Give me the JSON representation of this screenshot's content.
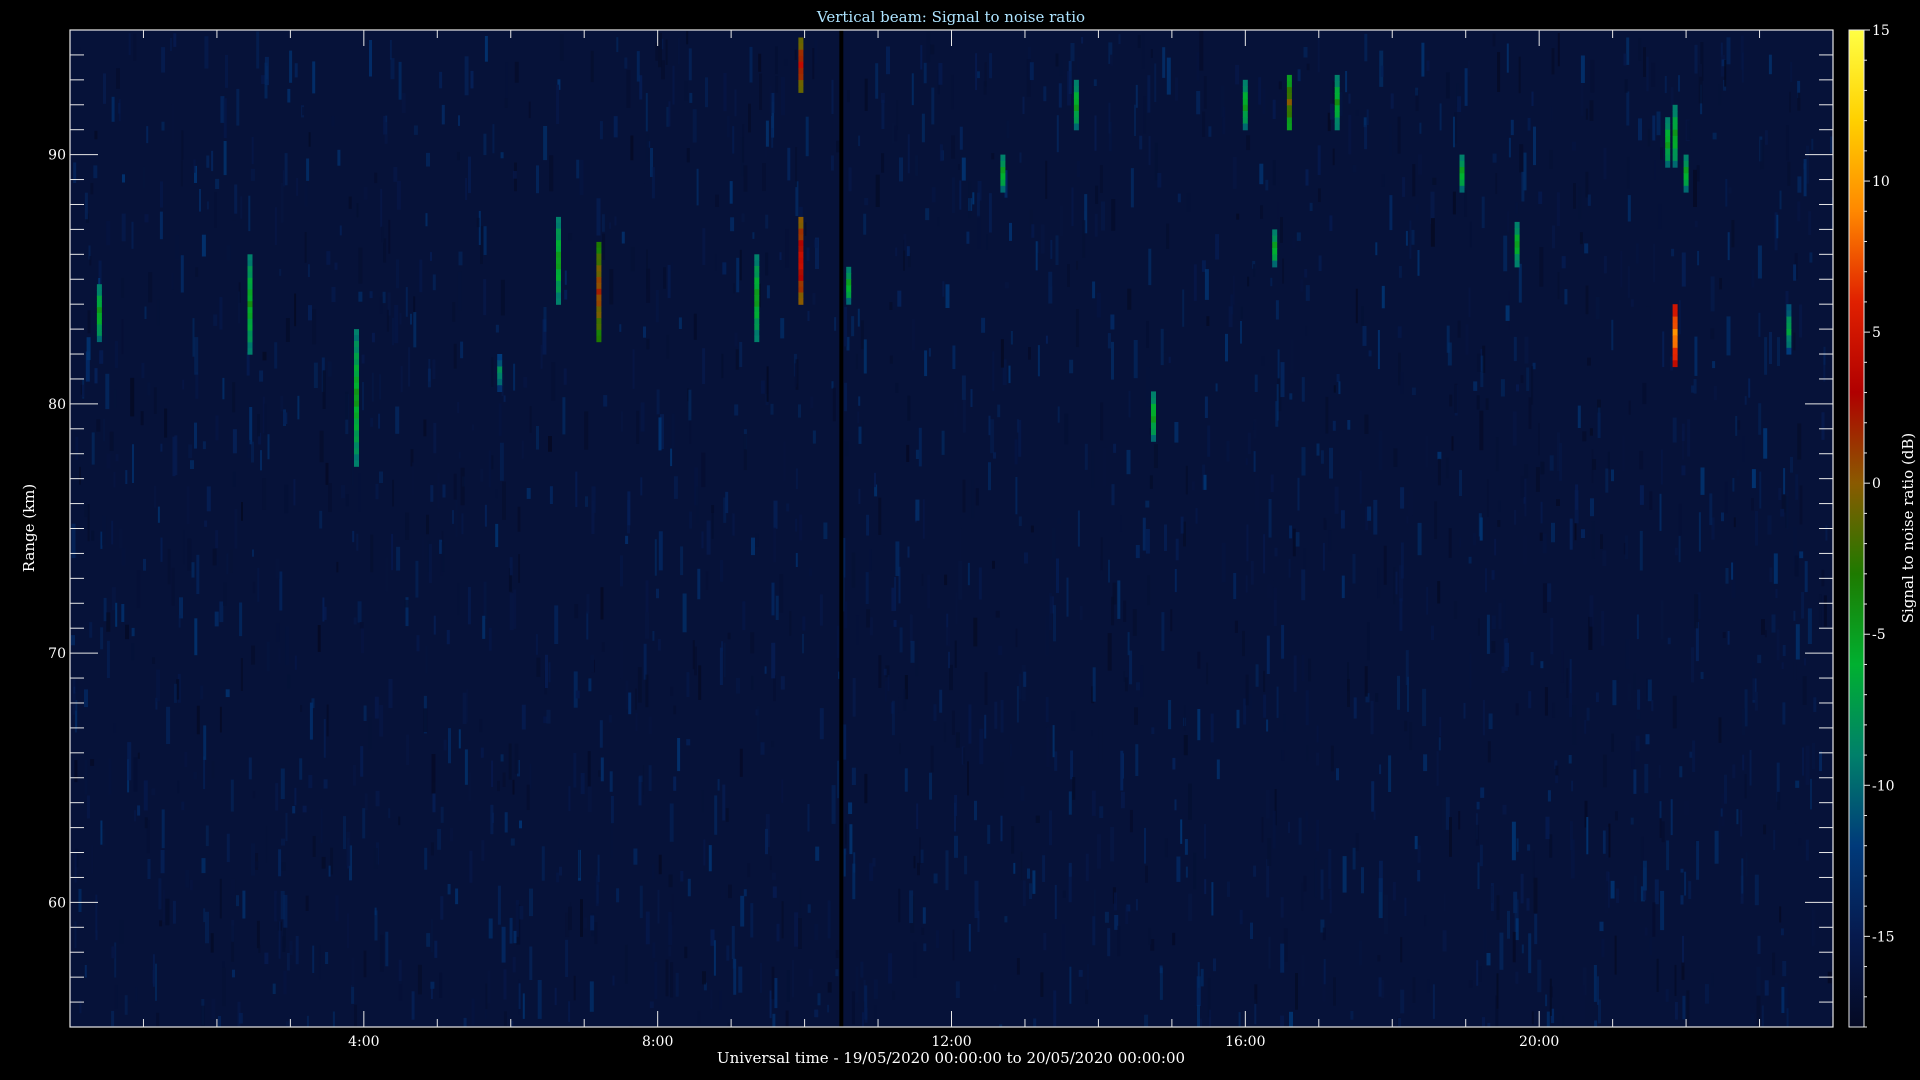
{
  "chart_data": {
    "type": "heatmap",
    "title": "Vertical beam: Signal to noise ratio",
    "xlabel": "Universal time - 19/05/2020 00:00:00 to 20/05/2020 00:00:00",
    "ylabel": "Range (km)",
    "colorbar_label": "Signal to noise ratio (dB)",
    "xlim": [
      0,
      24
    ],
    "ylim": [
      55,
      95
    ],
    "clim": [
      -18,
      15
    ],
    "x_ticks": [
      4,
      8,
      12,
      16,
      20
    ],
    "x_tick_labels": [
      "4:00",
      "8:00",
      "12:00",
      "16:00",
      "20:00"
    ],
    "y_ticks": [
      60,
      70,
      80,
      90
    ],
    "y_tick_labels": [
      "60",
      "70",
      "80",
      "90"
    ],
    "colorbar_ticks": [
      15,
      10,
      5,
      0,
      -5,
      -10,
      -15
    ],
    "colorbar_tick_labels": [
      "15",
      "10",
      "5",
      "0",
      "-5",
      "-10",
      "-15"
    ],
    "colormap": [
      "#ffff44",
      "#ffd000",
      "#ff8800",
      "#e02000",
      "#b00000",
      "#8a5a00",
      "#1e7a00",
      "#00b030",
      "#00806a",
      "#003a7a",
      "#061a4e",
      "#050a24"
    ],
    "background_level": -16,
    "data_gap_hours": 10.5,
    "events": [
      {
        "t": 0.4,
        "r_start": 82.5,
        "r_end": 84.8,
        "snr": -4
      },
      {
        "t": 2.45,
        "r_start": 82.0,
        "r_end": 86.0,
        "snr": -4
      },
      {
        "t": 3.9,
        "r_start": 77.5,
        "r_end": 83.0,
        "snr": -4
      },
      {
        "t": 5.85,
        "r_start": 80.5,
        "r_end": 82.0,
        "snr": -7
      },
      {
        "t": 6.65,
        "r_start": 84.0,
        "r_end": 87.5,
        "snr": -4
      },
      {
        "t": 7.2,
        "r_start": 82.5,
        "r_end": 86.5,
        "snr": 2
      },
      {
        "t": 9.35,
        "r_start": 82.5,
        "r_end": 86.0,
        "snr": -4
      },
      {
        "t": 9.95,
        "r_start": 84.0,
        "r_end": 87.5,
        "snr": 5
      },
      {
        "t": 9.95,
        "r_start": 92.5,
        "r_end": 94.7,
        "snr": 4
      },
      {
        "t": 10.6,
        "r_start": 84.0,
        "r_end": 85.5,
        "snr": -4
      },
      {
        "t": 12.7,
        "r_start": 88.5,
        "r_end": 90.0,
        "snr": -4
      },
      {
        "t": 13.7,
        "r_start": 91.0,
        "r_end": 93.0,
        "snr": -4
      },
      {
        "t": 14.75,
        "r_start": 78.5,
        "r_end": 80.5,
        "snr": -4
      },
      {
        "t": 16.0,
        "r_start": 91.0,
        "r_end": 93.0,
        "snr": -4
      },
      {
        "t": 16.4,
        "r_start": 85.5,
        "r_end": 87.0,
        "snr": -4
      },
      {
        "t": 16.6,
        "r_start": 91.0,
        "r_end": 93.2,
        "snr": 0
      },
      {
        "t": 17.25,
        "r_start": 91.0,
        "r_end": 93.2,
        "snr": -4
      },
      {
        "t": 18.95,
        "r_start": 88.5,
        "r_end": 90.0,
        "snr": -4
      },
      {
        "t": 19.7,
        "r_start": 85.5,
        "r_end": 87.3,
        "snr": -4
      },
      {
        "t": 21.75,
        "r_start": 89.5,
        "r_end": 91.5,
        "snr": -4
      },
      {
        "t": 21.85,
        "r_start": 81.5,
        "r_end": 84.0,
        "snr": 10
      },
      {
        "t": 21.85,
        "r_start": 89.5,
        "r_end": 92.0,
        "snr": -4
      },
      {
        "t": 22.0,
        "r_start": 88.5,
        "r_end": 90.0,
        "snr": -4
      },
      {
        "t": 23.4,
        "r_start": 82.0,
        "r_end": 84.0,
        "snr": -6
      }
    ]
  }
}
